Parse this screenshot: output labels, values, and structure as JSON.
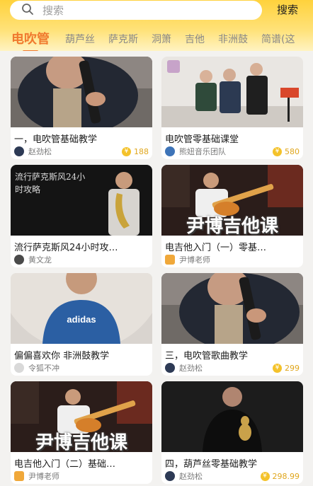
{
  "search": {
    "placeholder": "搜索",
    "button": "搜索"
  },
  "tabs": [
    "电吹管",
    "葫芦丝",
    "萨克斯",
    "洞箫",
    "吉他",
    "非洲鼓",
    "简谱(这"
  ],
  "courses": [
    {
      "title": "一，电吹管基础教学",
      "author": "赵劲松",
      "price": "188"
    },
    {
      "title": "电吹管零基础课堂",
      "author": "熊妞音乐团队",
      "price": "580"
    },
    {
      "title": "流行萨克斯风24小时攻…",
      "author": "黄文龙",
      "price": ""
    },
    {
      "title": "电吉他入门（一）零基…",
      "author": "尹博老师",
      "price": ""
    },
    {
      "title": "偏偏喜欢你 非洲鼓教学",
      "author": "令狐不冲",
      "price": ""
    },
    {
      "title": "三，电吹管歌曲教学",
      "author": "赵劲松",
      "price": "299"
    },
    {
      "title": "电吉他入门（二）基础…",
      "author": "尹博老师",
      "price": ""
    },
    {
      "title": "四，葫芦丝零基础教学",
      "author": "赵劲松",
      "price": "298.99"
    }
  ],
  "overlays": {
    "sax": "流行萨克斯风24小时攻略",
    "guitar": "尹博吉他课"
  },
  "colors": {
    "accent": "#f07a2e",
    "price": "#e0a61c",
    "header": "#ffd23c"
  },
  "icons": {
    "search": "search-icon",
    "coin": "coin-icon"
  }
}
